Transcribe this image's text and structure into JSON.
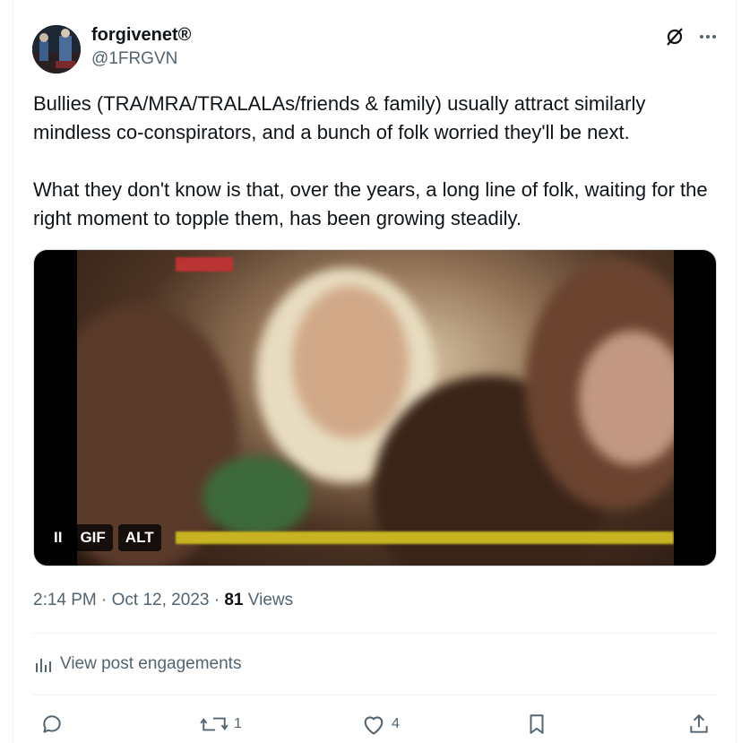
{
  "author": {
    "display_name": "forgivenet®",
    "handle": "@1FRGVN"
  },
  "post": {
    "paragraphs": [
      "Bullies (TRA/MRA/TRALALAs/friends & family) usually attract similarly mindless co-conspirators, and a bunch of folk worried they'll be next.",
      "What they don't know is that, over the years, a long line of folk, waiting for the right moment to topple them, has been growing steadily."
    ]
  },
  "media": {
    "type": "gif",
    "pause_label": "II",
    "gif_label": "GIF",
    "alt_label": "ALT"
  },
  "meta": {
    "time": "2:14 PM",
    "separator": "·",
    "date": "Oct 12, 2023",
    "views_count": "81",
    "views_label": "Views"
  },
  "engagements": {
    "label": "View post engagements"
  },
  "actions": {
    "reply_count": "",
    "repost_count": "1",
    "like_count": "4"
  },
  "colors": {
    "text": "#0f1419",
    "muted": "#536471",
    "border": "#eff3f4"
  }
}
